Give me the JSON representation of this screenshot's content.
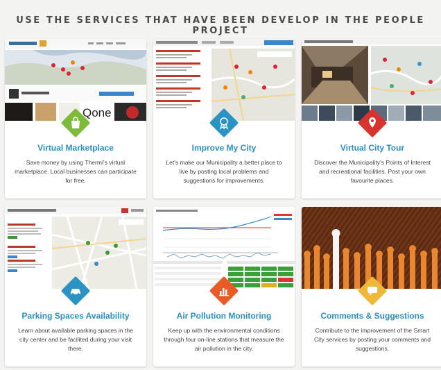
{
  "heading": "USE THE SERVICES THAT HAVE BEEN DEVELOP IN THE PEOPLE PROJECT",
  "cards": [
    {
      "title": "Virtual Marketplace",
      "description": "Save money by using Thermi's virtual marketplace. Local businesses can participate for free.",
      "icon": "shopping-bag-icon",
      "color": "#7dbb3a"
    },
    {
      "title": "Improve My City",
      "description": "Let's make our Municipality a better place to live by posting local problems and suggestions for improvements.",
      "icon": "award-ribbon-icon",
      "color": "#2b93c4"
    },
    {
      "title": "Virtual City Tour",
      "description": "Discover the Municipality's Points of Interest and recreational facilities. Post your own favourite places.",
      "icon": "map-pin-icon",
      "color": "#d8332f"
    },
    {
      "title": "Parking Spaces Availability",
      "description": "Learn about available parking spaces in the city center and be facilited during your visit there.",
      "icon": "car-icon",
      "color": "#2b93c4"
    },
    {
      "title": "Air Pollution Monitoring",
      "description": "Keep up with the environmental conditions through four on-line stations that measure the air pollution in the city.",
      "icon": "bar-chart-icon",
      "color": "#ea5a24"
    },
    {
      "title": "Comments & Suggestions",
      "description": "Contribute to the improvement of the Smart City services by posting your comments and suggestions.",
      "icon": "speech-bubble-icon",
      "color": "#efb83a"
    }
  ]
}
